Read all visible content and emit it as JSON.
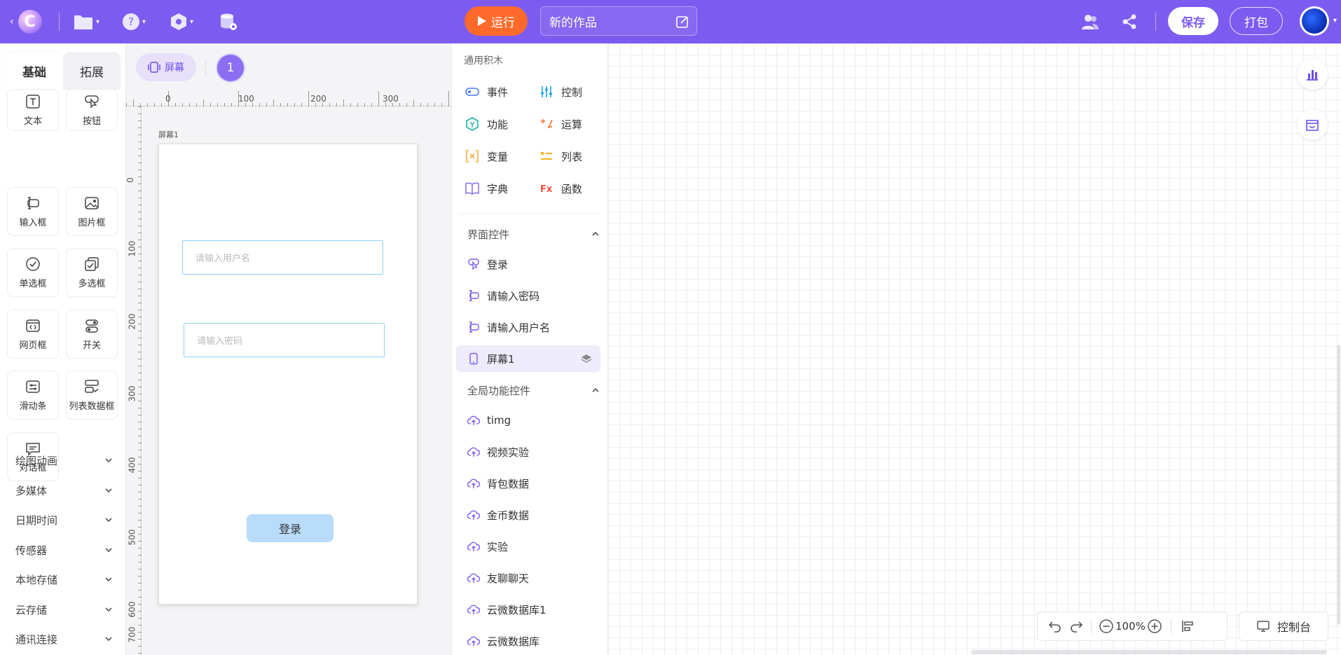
{
  "topbar": {
    "run_label": "运行",
    "project_title": "新的作品",
    "save_label": "保存",
    "pack_label": "打包",
    "accent_color": "#7c5cf0",
    "run_color": "#ff6a2b"
  },
  "left_panel": {
    "tabs": [
      {
        "label": "基础",
        "active": true
      },
      {
        "label": "拓展",
        "active": false
      }
    ],
    "components": [
      {
        "label": "文本",
        "icon": "text-icon"
      },
      {
        "label": "按钮",
        "icon": "pointer-icon"
      },
      {
        "label": "输入框",
        "icon": "input-icon"
      },
      {
        "label": "图片框",
        "icon": "image-icon"
      },
      {
        "label": "单选框",
        "icon": "radio-icon"
      },
      {
        "label": "多选框",
        "icon": "checkbox-icon"
      },
      {
        "label": "网页框",
        "icon": "webview-icon"
      },
      {
        "label": "开关",
        "icon": "switch-icon"
      },
      {
        "label": "滑动条",
        "icon": "slider-icon"
      },
      {
        "label": "列表数据框",
        "icon": "list-data-icon"
      },
      {
        "label": "对话框",
        "icon": "dialog-icon"
      }
    ],
    "categories": [
      "绘图动画",
      "多媒体",
      "日期时间",
      "传感器",
      "本地存储",
      "云存储",
      "通讯连接"
    ]
  },
  "canvas": {
    "screen_button_label": "屏幕",
    "screen_count": "1",
    "screen_name": "屏幕1",
    "ruler_h_ticks": [
      "0",
      "100",
      "200",
      "300"
    ],
    "ruler_v_ticks": [
      "0",
      "100",
      "200",
      "300",
      "400",
      "500",
      "600",
      "700"
    ],
    "username_placeholder": "请输入用户名",
    "password_placeholder": "请输入密码",
    "login_button_label": "登录"
  },
  "palette": {
    "title": "通用积木",
    "blocks": [
      {
        "label": "事件",
        "icon": "event-icon",
        "color": "#4a7cf0"
      },
      {
        "label": "控制",
        "icon": "control-icon",
        "color": "#20a8e8"
      },
      {
        "label": "功能",
        "icon": "function-icon",
        "color": "#18b5a5"
      },
      {
        "label": "运算",
        "icon": "operation-icon",
        "color": "#f07a3a"
      },
      {
        "label": "变量",
        "icon": "variable-icon",
        "color": "#f5a93a"
      },
      {
        "label": "列表",
        "icon": "list-icon",
        "color": "#f0b830"
      },
      {
        "label": "字典",
        "icon": "dictionary-icon",
        "color": "#8a6cf0"
      },
      {
        "label": "函数",
        "icon": "fx-icon",
        "color": "#f0503a"
      }
    ],
    "ui_controls_title": "界面控件",
    "ui_controls": [
      {
        "label": "登录",
        "icon": "pointer-icon"
      },
      {
        "label": "请输入密码",
        "icon": "input-icon"
      },
      {
        "label": "请输入用户名",
        "icon": "input-icon"
      },
      {
        "label": "屏幕1",
        "icon": "phone-icon",
        "active": true
      }
    ],
    "global_controls_title": "全局功能控件",
    "global_controls": [
      "timg",
      "视频实验",
      "背包数据",
      "金币数据",
      "实验",
      "友聊聊天",
      "云微数据库1",
      "云微数据库"
    ]
  },
  "workspace": {
    "zoom_level": "100%",
    "console_label": "控制台"
  }
}
